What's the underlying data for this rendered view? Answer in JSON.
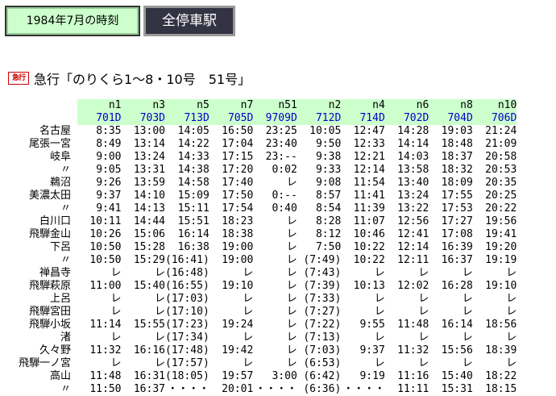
{
  "header": {
    "date_label": "1984年7月の時刻",
    "mode_label": "全停車駅"
  },
  "train": {
    "badge": "急行",
    "title": "急行「のりくら1～8・10号　51号」"
  },
  "columns": [
    {
      "num": "n1",
      "code": "701D"
    },
    {
      "num": "n3",
      "code": "703D"
    },
    {
      "num": "n5",
      "code": "713D"
    },
    {
      "num": "n7",
      "code": "705D"
    },
    {
      "num": "n51",
      "code": "9709D"
    },
    {
      "num": "n2",
      "code": "712D"
    },
    {
      "num": "n4",
      "code": "714D"
    },
    {
      "num": "n6",
      "code": "702D"
    },
    {
      "num": "n8",
      "code": "704D"
    },
    {
      "num": "n10",
      "code": "706D"
    }
  ],
  "rows": [
    {
      "station": "名古屋",
      "times": [
        "8:35",
        "13:00",
        "14:05",
        "16:50",
        "23:25",
        "10:05",
        "12:47",
        "14:28",
        "19:03",
        "21:24"
      ]
    },
    {
      "station": "尾張一宮",
      "times": [
        "8:49",
        "13:14",
        "14:22",
        "17:04",
        "23:40",
        "9:50",
        "12:33",
        "14:14",
        "18:48",
        "21:09"
      ]
    },
    {
      "station": "岐阜",
      "times": [
        "9:00",
        "13:24",
        "14:33",
        "17:15",
        "23:--",
        "9:38",
        "12:21",
        "14:03",
        "18:37",
        "20:58"
      ]
    },
    {
      "station": "〃",
      "times": [
        "9:05",
        "13:31",
        "14:38",
        "17:20",
        "0:02",
        "9:33",
        "12:14",
        "13:58",
        "18:32",
        "20:53"
      ]
    },
    {
      "station": "鵜沼",
      "times": [
        "9:26",
        "13:59",
        "14:58",
        "17:40",
        "レ",
        "9:08",
        "11:54",
        "13:40",
        "18:09",
        "20:35"
      ]
    },
    {
      "station": "美濃太田",
      "times": [
        "9:37",
        "14:10",
        "15:09",
        "17:50",
        "0:--",
        "8:57",
        "11:41",
        "13:24",
        "17:55",
        "20:25"
      ]
    },
    {
      "station": "〃",
      "times": [
        "9:41",
        "14:13",
        "15:11",
        "17:54",
        "0:40",
        "8:54",
        "11:39",
        "13:22",
        "17:53",
        "20:22"
      ]
    },
    {
      "station": "白川口",
      "times": [
        "10:11",
        "14:44",
        "15:51",
        "18:23",
        "レ",
        "8:28",
        "11:07",
        "12:56",
        "17:27",
        "19:56"
      ]
    },
    {
      "station": "飛騨金山",
      "times": [
        "10:26",
        "15:06",
        "16:14",
        "18:38",
        "レ",
        "8:12",
        "10:46",
        "12:41",
        "17:08",
        "19:41"
      ]
    },
    {
      "station": "下呂",
      "times": [
        "10:50",
        "15:28",
        "16:38",
        "19:00",
        "レ",
        "7:50",
        "10:22",
        "12:14",
        "16:39",
        "19:20"
      ]
    },
    {
      "station": "〃",
      "times": [
        "10:50",
        "15:29",
        "(16:41)",
        "19:00",
        "レ",
        "(7:49)",
        "10:22",
        "12:11",
        "16:37",
        "19:19"
      ]
    },
    {
      "station": "禅昌寺",
      "times": [
        "レ",
        "レ",
        "(16:48)",
        "レ",
        "レ",
        "(7:43)",
        "レ",
        "レ",
        "レ",
        "レ"
      ]
    },
    {
      "station": "飛騨萩原",
      "times": [
        "11:00",
        "15:40",
        "(16:55)",
        "19:10",
        "レ",
        "(7:39)",
        "10:13",
        "12:02",
        "16:28",
        "19:10"
      ]
    },
    {
      "station": "上呂",
      "times": [
        "レ",
        "レ",
        "(17:03)",
        "レ",
        "レ",
        "(7:33)",
        "レ",
        "レ",
        "レ",
        "レ"
      ]
    },
    {
      "station": "飛騨宮田",
      "times": [
        "レ",
        "レ",
        "(17:10)",
        "レ",
        "レ",
        "(7:27)",
        "レ",
        "レ",
        "レ",
        "レ"
      ]
    },
    {
      "station": "飛騨小坂",
      "times": [
        "11:14",
        "15:55",
        "(17:23)",
        "19:24",
        "レ",
        "(7:22)",
        "9:55",
        "11:48",
        "16:14",
        "18:56"
      ]
    },
    {
      "station": "渚",
      "times": [
        "レ",
        "レ",
        "(17:34)",
        "レ",
        "レ",
        "(7:13)",
        "レ",
        "レ",
        "レ",
        "レ"
      ]
    },
    {
      "station": "久々野",
      "times": [
        "11:32",
        "16:16",
        "(17:48)",
        "19:42",
        "レ",
        "(7:03)",
        "9:37",
        "11:32",
        "15:56",
        "18:39"
      ]
    },
    {
      "station": "飛騨一ノ宮",
      "times": [
        "レ",
        "レ",
        "(17:57)",
        "レ",
        "レ",
        "(6:53)",
        "レ",
        "レ",
        "レ",
        "レ"
      ]
    },
    {
      "station": "高山",
      "times": [
        "11:48",
        "16:31",
        "(18:05)",
        "19:57",
        "3:00",
        "(6:42)",
        "9:19",
        "11:16",
        "15:40",
        "18:22"
      ]
    },
    {
      "station": "〃",
      "times": [
        "11:50",
        "16:37",
        "・・・・",
        "20:01",
        "・・・・",
        "(6:36)",
        "・・・・",
        "11:11",
        "15:31",
        "18:15"
      ]
    }
  ]
}
